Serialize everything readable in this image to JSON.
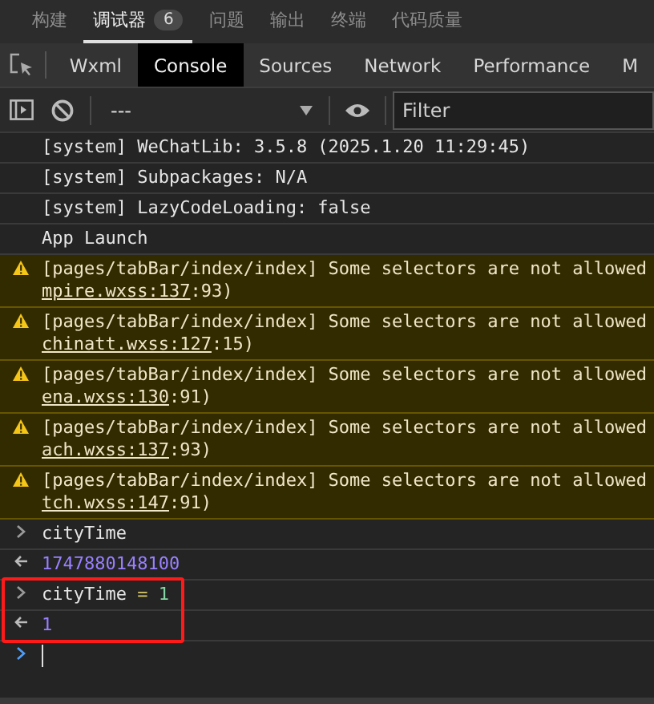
{
  "top_tabs": [
    {
      "label": "构建",
      "selected": false
    },
    {
      "label": "调试器",
      "selected": true,
      "badge": "6"
    },
    {
      "label": "问题",
      "selected": false
    },
    {
      "label": "输出",
      "selected": false
    },
    {
      "label": "终端",
      "selected": false
    },
    {
      "label": "代码质量",
      "selected": false
    }
  ],
  "devtools_tabs": [
    {
      "label": "Wxml",
      "selected": false
    },
    {
      "label": "Console",
      "selected": true
    },
    {
      "label": "Sources",
      "selected": false
    },
    {
      "label": "Network",
      "selected": false
    },
    {
      "label": "Performance",
      "selected": false
    },
    {
      "label": "M",
      "selected": false
    }
  ],
  "toolbar": {
    "context": "---",
    "filter": {
      "placeholder": "Filter"
    }
  },
  "console": [
    {
      "kind": "log",
      "text": "[system] WeChatLib: 3.5.8 (2025.1.20 11:29:45)",
      "highlighted": false
    },
    {
      "kind": "log",
      "text": "[system] Subpackages: N/A",
      "highlighted": false
    },
    {
      "kind": "log",
      "text": "[system] LazyCodeLoading: false",
      "highlighted": false
    },
    {
      "kind": "log",
      "text": "App Launch",
      "highlighted": false
    },
    {
      "kind": "warn",
      "text": "[pages/tabBar/index/index] Some selectors are not allowed",
      "link": "mpire.wxss:137",
      "suffix": ":93)",
      "highlighted": false
    },
    {
      "kind": "warn",
      "text": "[pages/tabBar/index/index] Some selectors are not allowed",
      "link": "chinatt.wxss:127",
      "suffix": ":15)",
      "highlighted": false
    },
    {
      "kind": "warn",
      "text": "[pages/tabBar/index/index] Some selectors are not allowed",
      "link": "ena.wxss:130",
      "suffix": ":91)",
      "highlighted": false
    },
    {
      "kind": "warn",
      "text": "[pages/tabBar/index/index] Some selectors are not allowed",
      "link": "ach.wxss:137",
      "suffix": ":93)",
      "highlighted": false
    },
    {
      "kind": "warn",
      "text": "[pages/tabBar/index/index] Some selectors are not allowed",
      "link": "tch.wxss:147",
      "suffix": ":91)",
      "highlighted": false
    },
    {
      "kind": "input",
      "text": "cityTime",
      "highlighted": false
    },
    {
      "kind": "output",
      "text": "1747880148100",
      "highlighted": false
    },
    {
      "kind": "input",
      "text": "cityTime",
      "operator": "=",
      "value": "1",
      "highlighted": true
    },
    {
      "kind": "output",
      "text": "1",
      "highlighted": true
    },
    {
      "kind": "prompt",
      "highlighted": false
    }
  ]
}
